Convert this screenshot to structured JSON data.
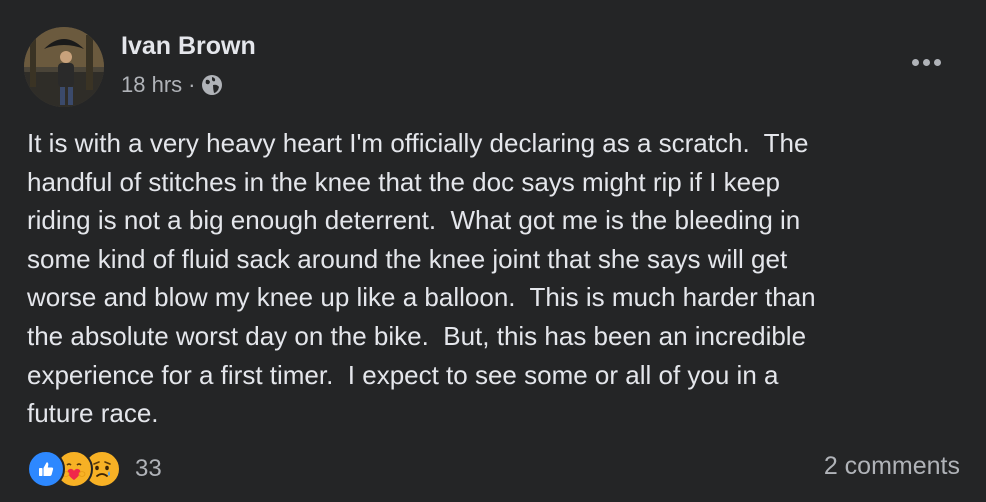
{
  "post": {
    "author": "Ivan Brown",
    "time": "18 hrs",
    "separator": "·",
    "privacy_icon": "globe-icon",
    "more_icon": "more-options-icon",
    "text": "It is with a very heavy heart I'm officially declaring as a scratch.  The\nhandful of stitches in the knee that the doc says might rip if I keep\nriding is not a big enough deterrent.  What got me is the bleeding in\nsome kind of fluid sack around the knee joint that she says will get\nworse and blow my knee up like a balloon.  This is much harder than\nthe absolute worst day on the bike.  But, this has been an incredible\nexperience for a first timer.  I expect to see some or all of you in a\nfuture race."
  },
  "footer": {
    "reactions": [
      "like-reaction-icon",
      "care-reaction-icon",
      "sad-reaction-icon"
    ],
    "reaction_count": "33",
    "comments_label": "2 comments"
  },
  "colors": {
    "background": "#242526",
    "primary_text": "#e4e6eb",
    "secondary_text": "#b0b3b8",
    "like_blue": "#2d88ff",
    "reaction_yellow": "#f7b125"
  }
}
